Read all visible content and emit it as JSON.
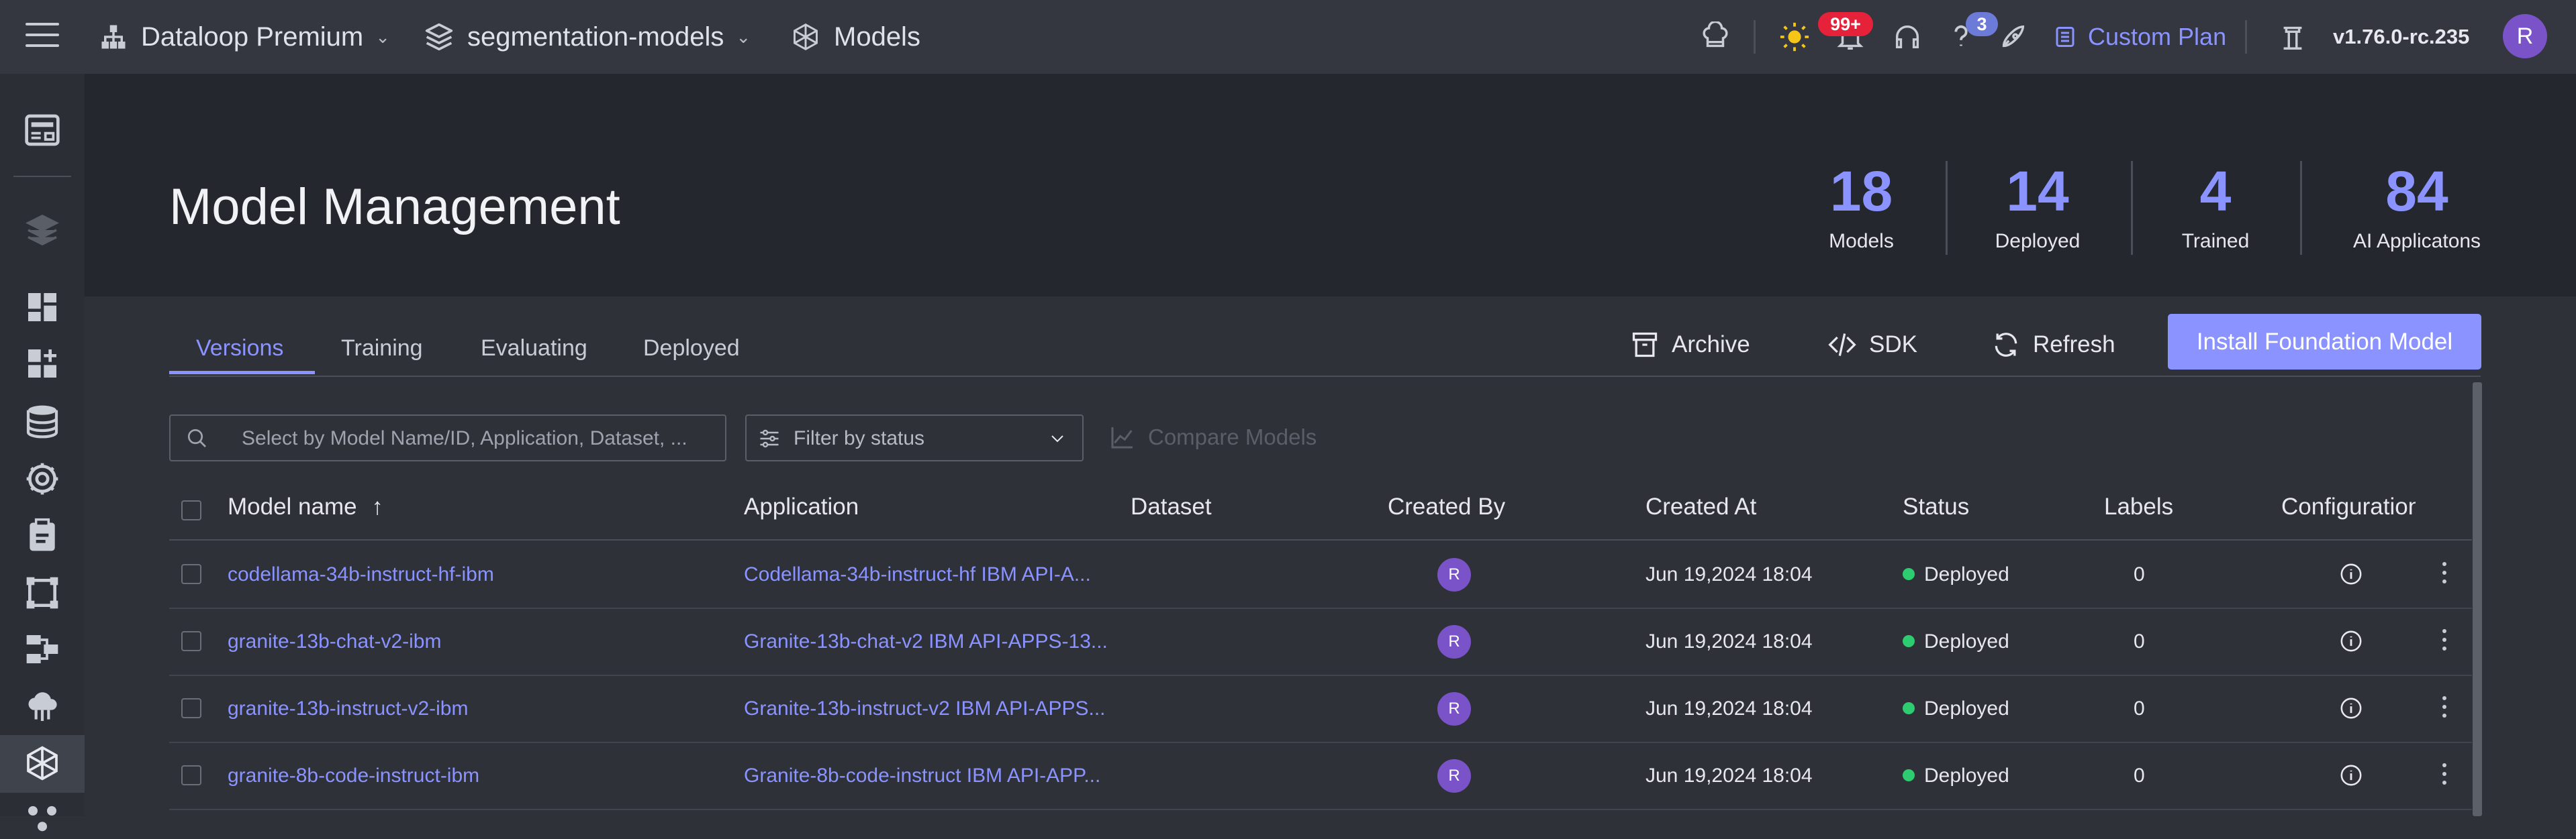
{
  "topbar": {
    "org": "Dataloop Premium",
    "project": "segmentation-models",
    "page": "Models",
    "notifications_badge": "99+",
    "help_badge": "3",
    "plan_label": "Custom Plan",
    "version": "v1.76.0-rc.235",
    "user_initial": "R"
  },
  "header": {
    "title": "Model Management",
    "stats": [
      {
        "value": "18",
        "label": "Models"
      },
      {
        "value": "14",
        "label": "Deployed"
      },
      {
        "value": "4",
        "label": "Trained"
      },
      {
        "value": "84",
        "label": "AI Applicatons"
      }
    ]
  },
  "tabs": [
    "Versions",
    "Training",
    "Evaluating",
    "Deployed"
  ],
  "actions": {
    "archive": "Archive",
    "sdk": "SDK",
    "refresh": "Refresh",
    "install": "Install Foundation Model"
  },
  "filters": {
    "search_placeholder": "Select by Model Name/ID, Application, Dataset, ...",
    "status_placeholder": "Filter by status",
    "compare_label": "Compare Models"
  },
  "table": {
    "columns": [
      "Model name",
      "Application",
      "Dataset",
      "Created By",
      "Created At",
      "Status",
      "Labels",
      "Configuration"
    ],
    "sort_indicator": "↑",
    "rows": [
      {
        "name": "codellama-34b-instruct-hf-ibm",
        "application": "Codellama-34b-instruct-hf IBM API-A...",
        "dataset": "",
        "created_by": "R",
        "created_at": "Jun 19,2024 18:04",
        "status": "Deployed",
        "labels": "0"
      },
      {
        "name": "granite-13b-chat-v2-ibm",
        "application": "Granite-13b-chat-v2 IBM API-APPS-13...",
        "dataset": "",
        "created_by": "R",
        "created_at": "Jun 19,2024 18:04",
        "status": "Deployed",
        "labels": "0"
      },
      {
        "name": "granite-13b-instruct-v2-ibm",
        "application": "Granite-13b-instruct-v2 IBM API-APPS...",
        "dataset": "",
        "created_by": "R",
        "created_at": "Jun 19,2024 18:04",
        "status": "Deployed",
        "labels": "0"
      },
      {
        "name": "granite-8b-code-instruct-ibm",
        "application": "Granite-8b-code-instruct IBM API-APP...",
        "dataset": "",
        "created_by": "R",
        "created_at": "Jun 19,2024 18:04",
        "status": "Deployed",
        "labels": "0"
      }
    ]
  },
  "colors": {
    "accent": "#8a93ff",
    "avatar": "#7b53c9",
    "status_deployed": "#2ecc71",
    "badge_red": "#e5223a",
    "badge_blue": "#6c7bd8"
  }
}
